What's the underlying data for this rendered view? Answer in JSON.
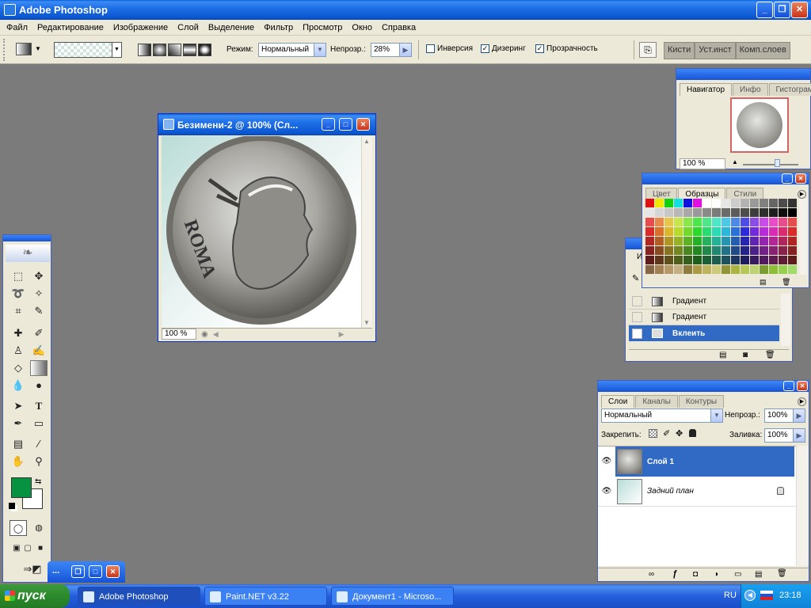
{
  "app": {
    "title": "Adobe Photoshop",
    "menu": [
      "Файл",
      "Редактирование",
      "Изображение",
      "Слой",
      "Выделение",
      "Фильтр",
      "Просмотр",
      "Окно",
      "Справка"
    ]
  },
  "options": {
    "mode_label": "Режим:",
    "mode_value": "Нормальный",
    "opacity_label": "Непрозр.:",
    "opacity_value": "28%",
    "reverse_label": "Инверсия",
    "dither_label": "Дизеринг",
    "transparency_label": "Прозрачность",
    "palette_wells": [
      "Кисти",
      "Уст.инст",
      "Комп.слоев"
    ]
  },
  "document": {
    "title": "Безимени-2 @ 100% (Сл...",
    "zoom": "100 %",
    "coin_text": "ROMA"
  },
  "navigator": {
    "tabs": [
      "Навигатор",
      "Инфо",
      "Гистограмма"
    ],
    "zoom": "100 %"
  },
  "swatches": {
    "tabs": [
      "Цвет",
      "Образцы",
      "Стили"
    ]
  },
  "history": {
    "items": [
      {
        "label": "Градиент"
      },
      {
        "label": "Градиент"
      },
      {
        "label": "Вклеить"
      }
    ]
  },
  "layers": {
    "tabs": [
      "Слои",
      "Каналы",
      "Контуры"
    ],
    "blend_mode": "Нормальный",
    "opacity_label": "Непрозр.:",
    "opacity_value": "100%",
    "lock_label": "Закрепить:",
    "fill_label": "Заливка:",
    "fill_value": "100%",
    "items": [
      {
        "name": "Слой 1"
      },
      {
        "name": "Задний план"
      }
    ]
  },
  "colors": {
    "foreground": "#079241",
    "background": "#ffffff",
    "titlebar": "#0a56d0",
    "selection": "#316ac5"
  },
  "taskbar": {
    "start_label": "пуск",
    "tasks": [
      {
        "label": "Adobe Photoshop"
      },
      {
        "label": "Paint.NET v3.22"
      },
      {
        "label": "Документ1 - Microso..."
      }
    ],
    "language": "RU",
    "clock": "23:18"
  }
}
